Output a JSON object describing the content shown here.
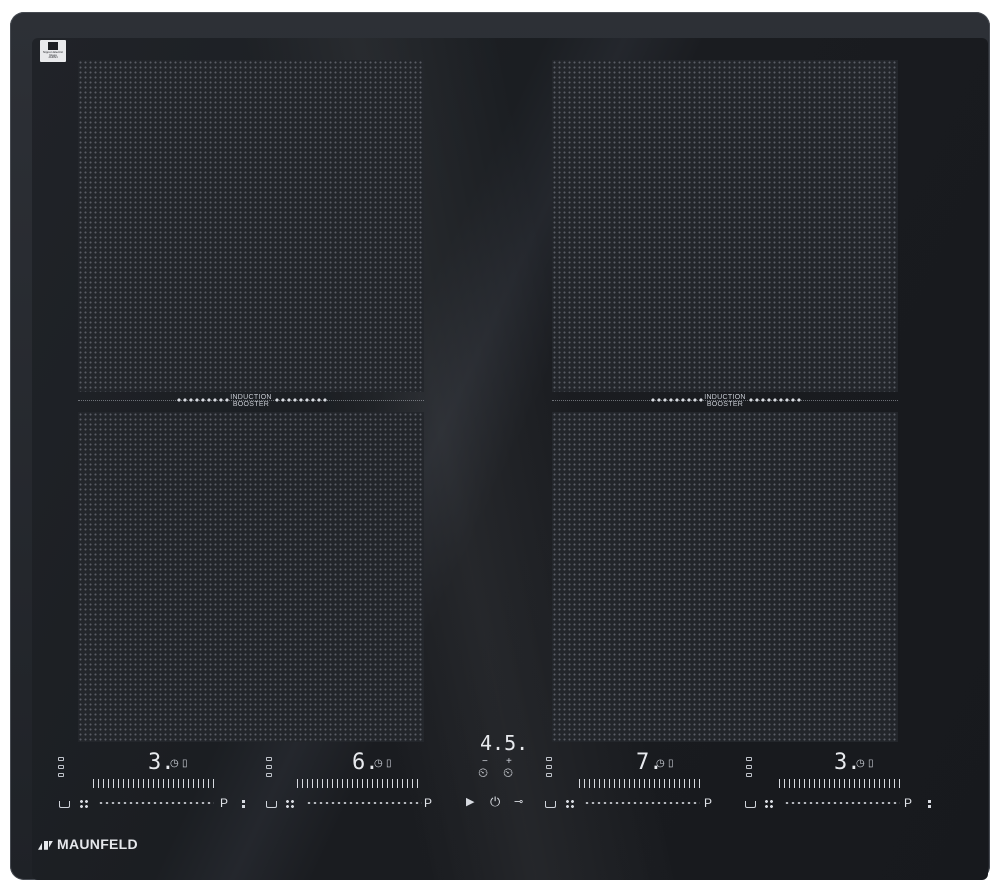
{
  "brand": {
    "name": "MAUNFELD"
  },
  "badge": {
    "line1": "Nippon Electric Glass",
    "line2": "JAPAN"
  },
  "booster_label": [
    "INDUCTION",
    "BOOSTER"
  ],
  "timer_display": "4.5.",
  "zones": [
    {
      "id": "zone-1",
      "level": "3."
    },
    {
      "id": "zone-2",
      "level": "6."
    },
    {
      "id": "zone-3",
      "level": "7."
    },
    {
      "id": "zone-4",
      "level": "3."
    }
  ],
  "controls": {
    "timer_minus": "−",
    "timer_plus": "+",
    "pause_symbol": "▶",
    "power_symbol": "⏻",
    "lock_symbol": "⊸",
    "pause_label": "P"
  },
  "colors": {
    "frame": "#2a2d33",
    "glass": "#1c1f23",
    "indicator": "#e8eaee"
  }
}
